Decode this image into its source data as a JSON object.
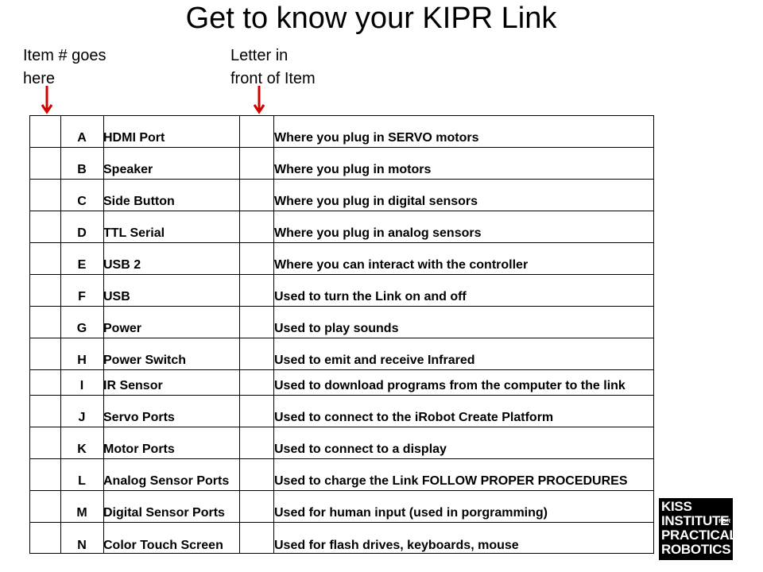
{
  "title": "Get to know your KIPR Link",
  "notes": {
    "left_line1": "Item # goes",
    "left_line2": "here",
    "right_line1": "Letter in",
    "right_line2": "front of Item"
  },
  "colors": {
    "arrow": "#d00000"
  },
  "rows": [
    {
      "letter": "A",
      "item": "HDMI Port",
      "use": "Where you plug in SERVO motors"
    },
    {
      "letter": "B",
      "item": "Speaker",
      "use": "Where you plug in motors"
    },
    {
      "letter": "C",
      "item": "Side Button",
      "use": "Where you plug in digital sensors"
    },
    {
      "letter": "D",
      "item": "TTL Serial",
      "use": "Where you plug  in analog sensors"
    },
    {
      "letter": "E",
      "item": "USB 2",
      "use": "Where you can interact with the controller"
    },
    {
      "letter": "F",
      "item": "USB",
      "use": "Used to turn the Link on and off"
    },
    {
      "letter": "G",
      "item": "Power",
      "use": "Used to play sounds"
    },
    {
      "letter": "H",
      "item": "Power Switch",
      "use": "Used to emit and receive Infrared"
    },
    {
      "letter": "I",
      "item": "IR Sensor",
      "use": "Used to download programs from the computer to the link"
    },
    {
      "letter": "J",
      "item": "Servo Ports",
      "use": "Used to connect to the iRobot Create Platform"
    },
    {
      "letter": "K",
      "item": "Motor Ports",
      "use": "Used to connect to a display"
    },
    {
      "letter": "L",
      "item": "Analog Sensor Ports",
      "use": "Used to charge the Link FOLLOW PROPER PROCEDURES"
    },
    {
      "letter": "M",
      "item": "Digital Sensor Ports",
      "use": "Used for human input (used in porgramming)"
    },
    {
      "letter": "N",
      "item": "Color Touch Screen",
      "use": "Used for flash drives, keyboards, mouse"
    }
  ],
  "logo": {
    "line1": "KISS",
    "line2": "INSTITUTE",
    "for": "FOR",
    "line3": "PRACTICAL",
    "line4": "ROBOTICS"
  }
}
